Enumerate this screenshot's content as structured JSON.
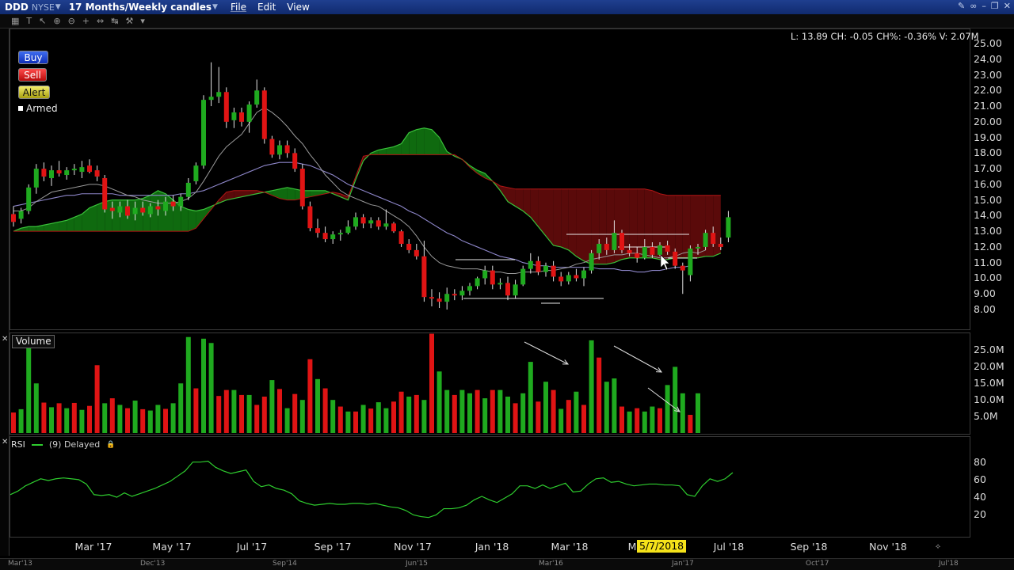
{
  "window": {
    "symbol": "DDD",
    "exchange": "NYSE",
    "period": "17 Months/Weekly candles",
    "menus": [
      "File",
      "Edit",
      "View"
    ]
  },
  "buttons": {
    "buy": "Buy",
    "sell": "Sell",
    "alert": "Alert",
    "armed": "Armed"
  },
  "quote_line": "L: 13.89 CH: -0.05 CH%: -0.36% V: 2.07M",
  "panels": {
    "volume_label": "Volume",
    "rsi_label": "RSI",
    "rsi_params": "(9) Delayed"
  },
  "axes": {
    "price_ticks": [
      "25.00",
      "24.00",
      "23.00",
      "22.00",
      "21.00",
      "20.00",
      "19.00",
      "18.00",
      "17.00",
      "16.00",
      "15.00",
      "14.00",
      "13.00",
      "12.00",
      "11.00",
      "10.00",
      "9.00",
      "8.00"
    ],
    "volume_ticks": [
      "25.0M",
      "20.0M",
      "15.0M",
      "10.0M",
      "5.0M"
    ],
    "rsi_ticks": [
      "80",
      "60",
      "40",
      "20"
    ],
    "date_labels": [
      "Mar '17",
      "May '17",
      "Jul '17",
      "Sep '17",
      "Nov '17",
      "Jan '18",
      "Mar '18",
      "Jul '18",
      "Sep '18",
      "Nov '18"
    ],
    "date_highlight": "5/7/2018",
    "date_highlight_prefix": "M",
    "bottom_labels": [
      "Mar'13",
      "Dec'13",
      "Sep'14",
      "Jun'15",
      "Mar'16",
      "Jan'17",
      "Oct'17",
      "Jul'18"
    ]
  },
  "colors": {
    "up": "#1faa1f",
    "down": "#e01414",
    "cloud_bull": "#0f6a0f",
    "cloud_bear": "#5a0a0a",
    "rsi": "#2ecc2e",
    "ma_fast": "#9a9a9a",
    "ma_slow": "#8d86c9"
  },
  "chart_data": {
    "type": "candlestick",
    "interval": "weekly",
    "price_range": [
      7.5,
      25.5
    ],
    "candles": [
      {
        "o": 14.1,
        "h": 14.6,
        "l": 13.3,
        "c": 13.6
      },
      {
        "o": 13.8,
        "h": 14.5,
        "l": 13.5,
        "c": 14.3
      },
      {
        "o": 14.3,
        "h": 16.0,
        "l": 14.1,
        "c": 15.8
      },
      {
        "o": 15.8,
        "h": 17.3,
        "l": 15.4,
        "c": 17.0
      },
      {
        "o": 17.0,
        "h": 17.4,
        "l": 16.2,
        "c": 16.5
      },
      {
        "o": 16.4,
        "h": 17.2,
        "l": 15.9,
        "c": 16.9
      },
      {
        "o": 16.9,
        "h": 17.5,
        "l": 16.5,
        "c": 16.7
      },
      {
        "o": 16.6,
        "h": 17.1,
        "l": 16.3,
        "c": 16.9
      },
      {
        "o": 16.9,
        "h": 17.3,
        "l": 16.6,
        "c": 17.0
      },
      {
        "o": 16.8,
        "h": 17.5,
        "l": 16.4,
        "c": 17.1
      },
      {
        "o": 17.2,
        "h": 17.6,
        "l": 16.7,
        "c": 16.8
      },
      {
        "o": 16.9,
        "h": 17.2,
        "l": 16.2,
        "c": 16.5
      },
      {
        "o": 16.4,
        "h": 16.6,
        "l": 14.2,
        "c": 14.4
      },
      {
        "o": 14.5,
        "h": 14.9,
        "l": 13.8,
        "c": 14.3
      },
      {
        "o": 14.2,
        "h": 14.9,
        "l": 13.9,
        "c": 14.6
      },
      {
        "o": 14.6,
        "h": 15.0,
        "l": 13.8,
        "c": 14.0
      },
      {
        "o": 14.1,
        "h": 14.9,
        "l": 13.7,
        "c": 14.5
      },
      {
        "o": 14.5,
        "h": 14.9,
        "l": 14.0,
        "c": 14.2
      },
      {
        "o": 14.1,
        "h": 14.8,
        "l": 13.9,
        "c": 14.6
      },
      {
        "o": 14.6,
        "h": 15.0,
        "l": 14.0,
        "c": 14.4
      },
      {
        "o": 14.3,
        "h": 15.2,
        "l": 14.0,
        "c": 14.9
      },
      {
        "o": 14.9,
        "h": 15.3,
        "l": 14.3,
        "c": 14.6
      },
      {
        "o": 14.6,
        "h": 15.4,
        "l": 14.3,
        "c": 15.2
      },
      {
        "o": 15.2,
        "h": 16.4,
        "l": 15.0,
        "c": 16.1
      },
      {
        "o": 16.2,
        "h": 17.4,
        "l": 16.0,
        "c": 17.2
      },
      {
        "o": 17.2,
        "h": 21.7,
        "l": 17.0,
        "c": 21.4
      },
      {
        "o": 21.4,
        "h": 23.8,
        "l": 21.0,
        "c": 21.6
      },
      {
        "o": 21.6,
        "h": 23.5,
        "l": 21.2,
        "c": 21.9
      },
      {
        "o": 21.9,
        "h": 22.2,
        "l": 19.6,
        "c": 20.0
      },
      {
        "o": 20.1,
        "h": 20.9,
        "l": 19.6,
        "c": 20.6
      },
      {
        "o": 20.6,
        "h": 20.9,
        "l": 19.7,
        "c": 20.0
      },
      {
        "o": 20.0,
        "h": 21.3,
        "l": 19.3,
        "c": 21.1
      },
      {
        "o": 21.1,
        "h": 22.7,
        "l": 20.9,
        "c": 22.0
      },
      {
        "o": 22.0,
        "h": 22.2,
        "l": 18.6,
        "c": 18.9
      },
      {
        "o": 18.9,
        "h": 19.1,
        "l": 17.7,
        "c": 17.9
      },
      {
        "o": 17.9,
        "h": 18.8,
        "l": 17.6,
        "c": 18.5
      },
      {
        "o": 18.5,
        "h": 18.8,
        "l": 17.7,
        "c": 18.0
      },
      {
        "o": 18.0,
        "h": 18.3,
        "l": 16.8,
        "c": 17.0
      },
      {
        "o": 17.0,
        "h": 17.3,
        "l": 14.4,
        "c": 14.6
      },
      {
        "o": 14.6,
        "h": 14.9,
        "l": 13.0,
        "c": 13.2
      },
      {
        "o": 13.2,
        "h": 13.8,
        "l": 12.6,
        "c": 12.9
      },
      {
        "o": 12.9,
        "h": 13.3,
        "l": 12.3,
        "c": 12.5
      },
      {
        "o": 12.5,
        "h": 13.0,
        "l": 12.2,
        "c": 12.8
      },
      {
        "o": 12.8,
        "h": 13.1,
        "l": 12.4,
        "c": 12.9
      },
      {
        "o": 12.9,
        "h": 13.7,
        "l": 12.8,
        "c": 13.3
      },
      {
        "o": 13.3,
        "h": 14.2,
        "l": 13.1,
        "c": 13.9
      },
      {
        "o": 13.9,
        "h": 14.1,
        "l": 13.2,
        "c": 13.5
      },
      {
        "o": 13.5,
        "h": 13.9,
        "l": 13.2,
        "c": 13.7
      },
      {
        "o": 13.7,
        "h": 13.9,
        "l": 13.1,
        "c": 13.3
      },
      {
        "o": 13.3,
        "h": 14.4,
        "l": 13.1,
        "c": 13.5
      },
      {
        "o": 13.5,
        "h": 13.6,
        "l": 12.9,
        "c": 13.0
      },
      {
        "o": 13.0,
        "h": 13.1,
        "l": 12.0,
        "c": 12.2
      },
      {
        "o": 12.2,
        "h": 12.5,
        "l": 11.6,
        "c": 11.8
      },
      {
        "o": 11.8,
        "h": 12.2,
        "l": 11.2,
        "c": 11.4
      },
      {
        "o": 11.4,
        "h": 12.4,
        "l": 8.5,
        "c": 8.8
      },
      {
        "o": 8.8,
        "h": 9.3,
        "l": 8.2,
        "c": 8.7
      },
      {
        "o": 8.7,
        "h": 9.1,
        "l": 8.1,
        "c": 8.5
      },
      {
        "o": 8.5,
        "h": 9.4,
        "l": 8.0,
        "c": 9.0
      },
      {
        "o": 9.0,
        "h": 9.3,
        "l": 8.6,
        "c": 8.9
      },
      {
        "o": 8.9,
        "h": 9.5,
        "l": 8.6,
        "c": 9.2
      },
      {
        "o": 9.2,
        "h": 9.7,
        "l": 8.9,
        "c": 9.5
      },
      {
        "o": 9.5,
        "h": 10.1,
        "l": 9.3,
        "c": 10.0
      },
      {
        "o": 10.0,
        "h": 10.8,
        "l": 9.6,
        "c": 10.5
      },
      {
        "o": 10.5,
        "h": 10.8,
        "l": 9.3,
        "c": 9.6
      },
      {
        "o": 9.6,
        "h": 10.0,
        "l": 9.3,
        "c": 9.7
      },
      {
        "o": 9.7,
        "h": 10.1,
        "l": 8.6,
        "c": 8.9
      },
      {
        "o": 8.9,
        "h": 9.9,
        "l": 8.7,
        "c": 9.6
      },
      {
        "o": 9.6,
        "h": 10.8,
        "l": 9.5,
        "c": 10.6
      },
      {
        "o": 10.6,
        "h": 11.6,
        "l": 10.3,
        "c": 11.1
      },
      {
        "o": 11.1,
        "h": 11.4,
        "l": 10.2,
        "c": 10.4
      },
      {
        "o": 10.4,
        "h": 11.0,
        "l": 10.1,
        "c": 10.8
      },
      {
        "o": 10.8,
        "h": 11.1,
        "l": 9.8,
        "c": 10.1
      },
      {
        "o": 10.1,
        "h": 10.4,
        "l": 9.5,
        "c": 9.8
      },
      {
        "o": 9.8,
        "h": 10.4,
        "l": 9.6,
        "c": 10.2
      },
      {
        "o": 10.2,
        "h": 10.6,
        "l": 9.8,
        "c": 10.0
      },
      {
        "o": 10.0,
        "h": 10.7,
        "l": 9.5,
        "c": 10.5
      },
      {
        "o": 10.5,
        "h": 11.8,
        "l": 10.3,
        "c": 11.6
      },
      {
        "o": 11.6,
        "h": 12.5,
        "l": 11.2,
        "c": 12.2
      },
      {
        "o": 12.2,
        "h": 12.6,
        "l": 11.5,
        "c": 11.8
      },
      {
        "o": 11.8,
        "h": 13.7,
        "l": 11.6,
        "c": 12.9
      },
      {
        "o": 12.9,
        "h": 13.1,
        "l": 11.6,
        "c": 11.8
      },
      {
        "o": 11.8,
        "h": 12.2,
        "l": 11.4,
        "c": 11.6
      },
      {
        "o": 11.6,
        "h": 12.0,
        "l": 11.0,
        "c": 11.3
      },
      {
        "o": 11.3,
        "h": 12.5,
        "l": 11.2,
        "c": 12.0
      },
      {
        "o": 12.0,
        "h": 12.3,
        "l": 11.3,
        "c": 11.5
      },
      {
        "o": 11.5,
        "h": 12.3,
        "l": 11.4,
        "c": 12.1
      },
      {
        "o": 12.1,
        "h": 12.4,
        "l": 11.5,
        "c": 11.7
      },
      {
        "o": 11.7,
        "h": 11.9,
        "l": 10.6,
        "c": 10.8
      },
      {
        "o": 10.8,
        "h": 11.0,
        "l": 9.0,
        "c": 10.5
      },
      {
        "o": 10.2,
        "h": 12.1,
        "l": 9.8,
        "c": 11.9
      },
      {
        "o": 11.9,
        "h": 12.2,
        "l": 11.5,
        "c": 12.0
      },
      {
        "o": 12.0,
        "h": 13.1,
        "l": 11.8,
        "c": 12.9
      },
      {
        "o": 12.9,
        "h": 13.3,
        "l": 12.0,
        "c": 12.2
      },
      {
        "o": 12.2,
        "h": 12.6,
        "l": 11.8,
        "c": 12.0
      },
      {
        "o": 12.6,
        "h": 14.3,
        "l": 12.3,
        "c": 13.9
      }
    ],
    "ma_fast": [
      14.3,
      14.3,
      14.5,
      14.9,
      15.2,
      15.5,
      15.6,
      15.7,
      15.8,
      15.9,
      16.0,
      16.0,
      15.9,
      15.7,
      15.5,
      15.3,
      15.2,
      15.0,
      14.9,
      14.8,
      14.8,
      14.8,
      14.9,
      15.1,
      15.5,
      16.2,
      17.0,
      17.8,
      18.4,
      18.8,
      19.2,
      19.9,
      20.6,
      20.9,
      20.6,
      20.2,
      19.7,
      19.1,
      18.6,
      17.9,
      17.3,
      16.6,
      16.1,
      15.6,
      15.3,
      15.1,
      14.9,
      14.7,
      14.6,
      14.3,
      14.0,
      13.7,
      13.3,
      12.7,
      12.0,
      11.4,
      11.0,
      10.8,
      10.7,
      10.6,
      10.6,
      10.6,
      10.5,
      10.4,
      10.4,
      10.3,
      10.3,
      10.4,
      10.4,
      10.4,
      10.5,
      10.5,
      10.6,
      10.7,
      10.9,
      11.0,
      11.2,
      11.3,
      11.4,
      11.5,
      11.5,
      11.6,
      11.6,
      11.5,
      11.4,
      11.3,
      11.3,
      11.4,
      11.6,
      11.7,
      11.6,
      11.8
    ],
    "ma_slow": [
      14.6,
      14.7,
      14.8,
      14.9,
      15.0,
      15.1,
      15.2,
      15.3,
      15.3,
      15.4,
      15.4,
      15.4,
      15.4,
      15.4,
      15.3,
      15.3,
      15.3,
      15.3,
      15.3,
      15.3,
      15.3,
      15.3,
      15.4,
      15.4,
      15.5,
      15.6,
      15.8,
      16.0,
      16.2,
      16.4,
      16.6,
      16.8,
      17.0,
      17.2,
      17.3,
      17.4,
      17.4,
      17.4,
      17.3,
      17.2,
      17.0,
      16.8,
      16.6,
      16.3,
      16.0,
      15.8,
      15.6,
      15.4,
      15.2,
      15.0,
      14.8,
      14.6,
      14.3,
      14.1,
      13.8,
      13.5,
      13.2,
      12.9,
      12.7,
      12.4,
      12.2,
      12.0,
      11.8,
      11.6,
      11.4,
      11.3,
      11.2,
      11.0,
      10.9,
      10.8,
      10.8,
      10.7,
      10.7,
      10.7,
      10.7,
      10.7,
      10.7,
      10.6,
      10.6,
      10.6,
      10.5,
      10.5,
      10.4,
      10.4,
      10.5,
      10.5,
      10.6,
      10.7,
      10.7,
      10.8
    ],
    "cloud": {
      "span_a": [
        13.0,
        13.2,
        13.3,
        13.3,
        13.4,
        13.5,
        13.6,
        13.7,
        13.9,
        14.1,
        14.5,
        14.7,
        14.9,
        15.0,
        15.0,
        15.0,
        15.0,
        15.1,
        15.3,
        15.6,
        15.4,
        15.0,
        14.6,
        14.4,
        14.3,
        14.4,
        14.6,
        14.8,
        15.0,
        15.1,
        15.2,
        15.3,
        15.4,
        15.5,
        15.6,
        15.7,
        15.8,
        15.7,
        15.6,
        15.6,
        15.6,
        15.6,
        15.4,
        15.2,
        15.0,
        16.3,
        17.5,
        18.0,
        18.2,
        18.3,
        18.4,
        18.6,
        19.3,
        19.5,
        19.6,
        19.5,
        19.0,
        18.1,
        17.8,
        17.6,
        17.2,
        16.9,
        16.7,
        16.2,
        15.6,
        14.9,
        14.6,
        14.3,
        13.9,
        13.3,
        12.7,
        12.1,
        12.0,
        11.8,
        11.4,
        11.1,
        10.9,
        10.9,
        10.9,
        11.0,
        11.2,
        11.3,
        11.3,
        11.3,
        11.3,
        11.2,
        11.2,
        11.3,
        11.3,
        11.3,
        11.3,
        11.4,
        11.4,
        11.6
      ],
      "span_b": [
        13.0,
        13.0,
        13.0,
        13.0,
        13.0,
        13.0,
        13.0,
        13.0,
        13.0,
        13.0,
        13.0,
        13.0,
        13.0,
        13.0,
        13.0,
        13.0,
        13.0,
        13.0,
        13.0,
        13.0,
        13.0,
        13.0,
        13.0,
        13.0,
        13.2,
        13.8,
        14.4,
        15.0,
        15.5,
        15.6,
        15.6,
        15.6,
        15.6,
        15.5,
        15.3,
        15.1,
        15.0,
        15.0,
        15.1,
        15.2,
        15.3,
        15.4,
        15.5,
        15.4,
        15.2,
        16.5,
        17.8,
        17.9,
        17.9,
        17.9,
        17.9,
        17.9,
        17.9,
        17.9,
        17.9,
        17.9,
        17.9,
        17.9,
        17.9,
        17.6,
        17.1,
        16.7,
        16.4,
        16.2,
        15.9,
        15.8,
        15.7,
        15.7,
        15.7,
        15.7,
        15.7,
        15.7,
        15.7,
        15.7,
        15.7,
        15.7,
        15.7,
        15.7,
        15.7,
        15.7,
        15.7,
        15.7,
        15.7,
        15.7,
        15.6,
        15.4,
        15.3,
        15.3,
        15.3,
        15.3,
        15.3,
        15.3,
        15.3,
        15.3
      ]
    },
    "volume_range": [
      0,
      27.5
    ],
    "volume": [
      6.2,
      7.2,
      26.0,
      15.0,
      9.2,
      7.8,
      9.0,
      7.5,
      9.1,
      7.0,
      8.2,
      20.5,
      9.0,
      10.5,
      8.5,
      7.5,
      9.8,
      7.2,
      6.8,
      8.5,
      7.3,
      9.0,
      15.0,
      29.0,
      13.5,
      28.5,
      27.2,
      11.2,
      13.0,
      13.0,
      11.5,
      11.5,
      8.5,
      11.0,
      16.0,
      13.3,
      7.5,
      11.8,
      10.0,
      22.3,
      16.3,
      13.5,
      10.0,
      8.0,
      6.5,
      6.5,
      8.5,
      7.4,
      9.3,
      7.5,
      9.5,
      12.5,
      11.0,
      11.5,
      10.0,
      30.0,
      18.6,
      13.0,
      11.5,
      13.0,
      12.0,
      13.0,
      10.5,
      13.0,
      13.0,
      11.0,
      9.0,
      12.0,
      21.5,
      9.5,
      15.5,
      13.0,
      7.3,
      10.0,
      12.5,
      8.5,
      28.0,
      22.8,
      15.5,
      16.5,
      8.0,
      6.5,
      7.5,
      6.5,
      8.0,
      7.5,
      14.5,
      20.0,
      12.0,
      5.5,
      12.0
    ],
    "volume_up": [
      0,
      1,
      1,
      1,
      0,
      1,
      0,
      1,
      0,
      1,
      0,
      0,
      1,
      0,
      1,
      0,
      1,
      0,
      1,
      1,
      0,
      1,
      1,
      1,
      0,
      1,
      1,
      0,
      0,
      1,
      0,
      1,
      0,
      0,
      1,
      0,
      1,
      0,
      1,
      0,
      1,
      0,
      1,
      0,
      1,
      0,
      1,
      0,
      1,
      1,
      0,
      0,
      1,
      0,
      1,
      0,
      1,
      1,
      0,
      1,
      1,
      0,
      1,
      0,
      1,
      1,
      0,
      1,
      1,
      0,
      1,
      0,
      1,
      0,
      1,
      0,
      1,
      0,
      1,
      1,
      0,
      1,
      0,
      1,
      1,
      0,
      1,
      1,
      1,
      0,
      1
    ],
    "rsi_range": [
      5,
      95
    ],
    "rsi": [
      43,
      47,
      53,
      57,
      61,
      59,
      61,
      62,
      61,
      60,
      55,
      43,
      42,
      43,
      40,
      45,
      41,
      44,
      47,
      50,
      54,
      58,
      64,
      70,
      80,
      80,
      81,
      74,
      70,
      67,
      69,
      71,
      58,
      52,
      54,
      50,
      48,
      44,
      36,
      33,
      31,
      32,
      33,
      32,
      32,
      33,
      33,
      32,
      33,
      31,
      29,
      28,
      25,
      20,
      18,
      17,
      20,
      27,
      27,
      28,
      31,
      37,
      41,
      37,
      34,
      39,
      44,
      53,
      53,
      50,
      54,
      50,
      53,
      56,
      46,
      47,
      55,
      61,
      62,
      57,
      58,
      55,
      53,
      54,
      55,
      55,
      54,
      54,
      53,
      43,
      41,
      53,
      61,
      58,
      61,
      68
    ]
  }
}
